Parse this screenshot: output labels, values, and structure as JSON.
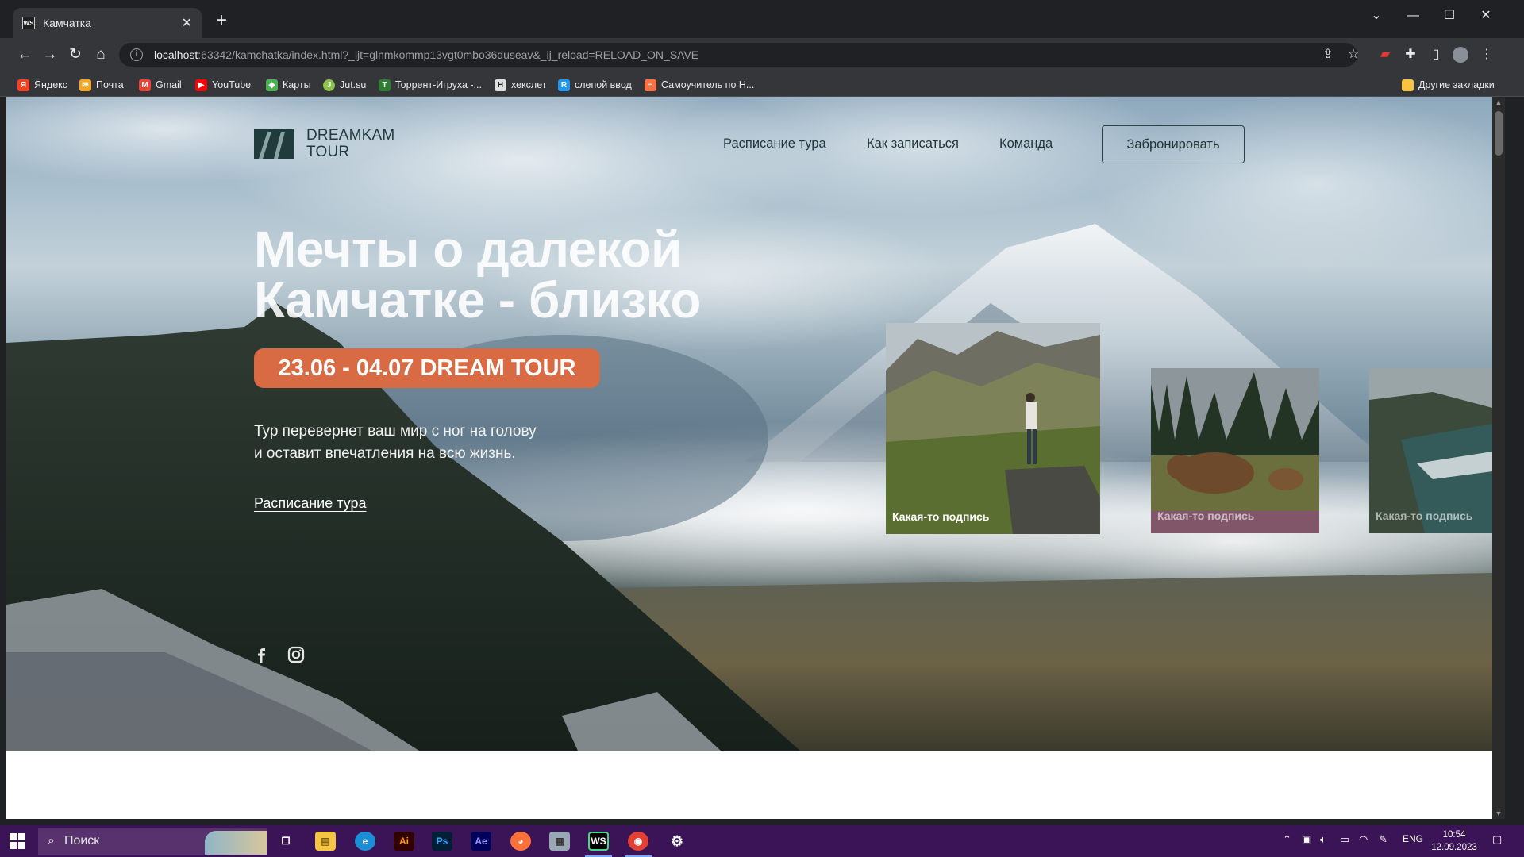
{
  "browser": {
    "tab_title": "Камчатка",
    "tab_favicon": "WS",
    "url_host": "localhost",
    "url_rest": ":63342/kamchatka/index.html?_ijt=glnmkommp13vgt0mbo36duseav&_ij_reload=RELOAD_ON_SAVE",
    "bookmarks": [
      {
        "label": "Яндекс",
        "icon": "yandex-icon",
        "color": "#fc3f1d"
      },
      {
        "label": "Почта",
        "icon": "mail-icon",
        "color": "#f5a623"
      },
      {
        "label": "Gmail",
        "icon": "gmail-icon",
        "color": "#ea4335"
      },
      {
        "label": "YouTube",
        "icon": "youtube-icon",
        "color": "#ff0000"
      },
      {
        "label": "Карты",
        "icon": "maps-icon",
        "color": "#4caf50"
      },
      {
        "label": "Jut.su",
        "icon": "jutsu-icon",
        "color": "#8bc34a"
      },
      {
        "label": "Торрент-Игруха -...",
        "icon": "torrent-icon",
        "color": "#2e7d32"
      },
      {
        "label": "хекслет",
        "icon": "hexlet-icon",
        "color": "#e0e0e0"
      },
      {
        "label": "слепой ввод",
        "icon": "typing-icon",
        "color": "#2196f3"
      },
      {
        "label": "Самоучитель по Н...",
        "icon": "tutorial-icon",
        "color": "#ff7043"
      }
    ],
    "other_bookmarks": "Другие закладки"
  },
  "site": {
    "logo_line1": "DREAMKAM",
    "logo_line2": "TOUR",
    "nav": [
      "Расписание тура",
      "Как записаться",
      "Команда"
    ],
    "book_button": "Забронировать",
    "headline_line1": "Мечты о далекой",
    "headline_line2": "Камчатке - близко",
    "badge": "23.06 - 04.07 DREAM TOUR",
    "lead_line1": "Тур перевернет ваш мир с ног на голову",
    "lead_line2": "и оставит впечатления на всю жизнь.",
    "schedule_link": "Расписание тура",
    "cards": [
      {
        "caption": "Какая-то подпись",
        "image": "hiker-on-rock"
      },
      {
        "caption": "Какая-то подпись",
        "image": "bears-in-meadow"
      },
      {
        "caption": "Какая-то подпись",
        "image": "sea-coast"
      }
    ],
    "social": [
      "facebook-icon",
      "instagram-icon"
    ],
    "colors": {
      "accent": "#d86a44",
      "dark_teal": "#1f3b3c"
    }
  },
  "taskbar": {
    "search_placeholder": "Поиск",
    "language": "ENG",
    "time": "10:54",
    "date": "12.09.2023",
    "apps": [
      "task-view-icon",
      "file-explorer-icon",
      "edge-icon",
      "illustrator-icon",
      "photoshop-icon",
      "after-effects-icon",
      "firefox-icon",
      "app-icon",
      "webstorm-icon",
      "chrome-icon",
      "settings-icon"
    ]
  }
}
